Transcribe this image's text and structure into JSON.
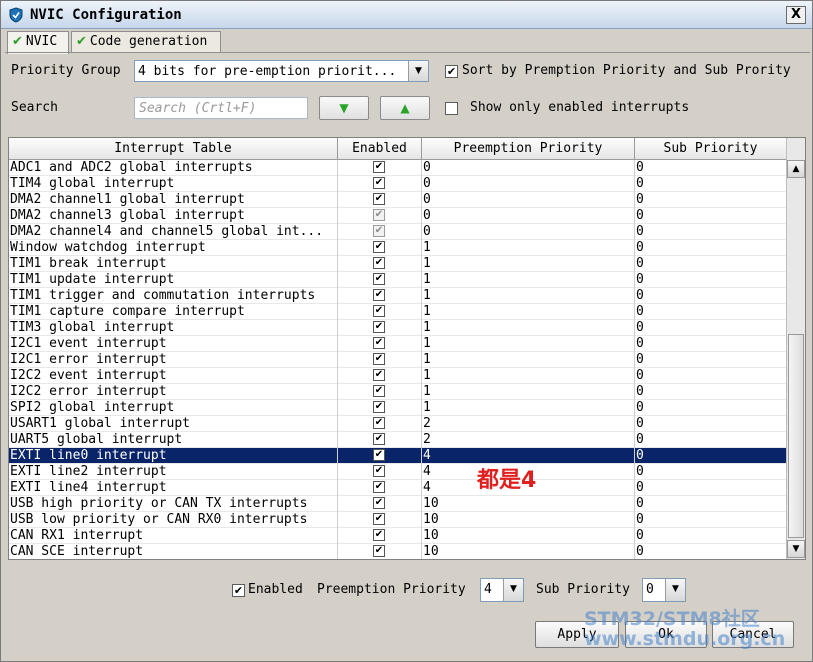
{
  "window": {
    "title": "NVIC Configuration",
    "close_label": "X"
  },
  "tabs": [
    {
      "label": "NVIC"
    },
    {
      "label": "Code generation"
    }
  ],
  "priority_group": {
    "label": "Priority Group",
    "value": "4 bits for pre-emption priorit..."
  },
  "sort": {
    "label": "Sort by Premption Priority and Sub Prority",
    "checked": true
  },
  "search": {
    "label": "Search",
    "placeholder": "Search (Crtl+F)"
  },
  "show_only_enabled": {
    "label": "Show only enabled interrupts",
    "checked": false
  },
  "table": {
    "columns": [
      "Interrupt Table",
      "Enabled",
      "Preemption Priority",
      "Sub Priority"
    ],
    "rows": [
      {
        "name": "ADC1 and ADC2 global interrupts",
        "enabled": true,
        "locked": false,
        "preemption": "0",
        "sub": "0"
      },
      {
        "name": "TIM4 global interrupt",
        "enabled": true,
        "locked": false,
        "preemption": "0",
        "sub": "0"
      },
      {
        "name": "DMA2 channel1 global interrupt",
        "enabled": true,
        "locked": false,
        "preemption": "0",
        "sub": "0"
      },
      {
        "name": "DMA2 channel3 global interrupt",
        "enabled": true,
        "locked": true,
        "preemption": "0",
        "sub": "0"
      },
      {
        "name": "DMA2 channel4 and channel5 global int...",
        "enabled": true,
        "locked": true,
        "preemption": "0",
        "sub": "0"
      },
      {
        "name": "Window watchdog interrupt",
        "enabled": true,
        "locked": false,
        "preemption": "1",
        "sub": "0"
      },
      {
        "name": "TIM1 break interrupt",
        "enabled": true,
        "locked": false,
        "preemption": "1",
        "sub": "0"
      },
      {
        "name": "TIM1 update interrupt",
        "enabled": true,
        "locked": false,
        "preemption": "1",
        "sub": "0"
      },
      {
        "name": "TIM1 trigger and commutation interrupts",
        "enabled": true,
        "locked": false,
        "preemption": "1",
        "sub": "0"
      },
      {
        "name": "TIM1 capture compare interrupt",
        "enabled": true,
        "locked": false,
        "preemption": "1",
        "sub": "0"
      },
      {
        "name": "TIM3 global interrupt",
        "enabled": true,
        "locked": false,
        "preemption": "1",
        "sub": "0"
      },
      {
        "name": "I2C1 event interrupt",
        "enabled": true,
        "locked": false,
        "preemption": "1",
        "sub": "0"
      },
      {
        "name": "I2C1 error interrupt",
        "enabled": true,
        "locked": false,
        "preemption": "1",
        "sub": "0"
      },
      {
        "name": "I2C2 event interrupt",
        "enabled": true,
        "locked": false,
        "preemption": "1",
        "sub": "0"
      },
      {
        "name": "I2C2 error interrupt",
        "enabled": true,
        "locked": false,
        "preemption": "1",
        "sub": "0"
      },
      {
        "name": "SPI2 global interrupt",
        "enabled": true,
        "locked": false,
        "preemption": "1",
        "sub": "0"
      },
      {
        "name": "USART1 global interrupt",
        "enabled": true,
        "locked": false,
        "preemption": "2",
        "sub": "0"
      },
      {
        "name": "UART5 global interrupt",
        "enabled": true,
        "locked": false,
        "preemption": "2",
        "sub": "0"
      },
      {
        "name": "EXTI line0 interrupt",
        "enabled": true,
        "locked": false,
        "preemption": "4",
        "sub": "0",
        "selected": true
      },
      {
        "name": "EXTI line2 interrupt",
        "enabled": true,
        "locked": false,
        "preemption": "4",
        "sub": "0"
      },
      {
        "name": "EXTI line4 interrupt",
        "enabled": true,
        "locked": false,
        "preemption": "4",
        "sub": "0"
      },
      {
        "name": "USB high priority or CAN TX interrupts",
        "enabled": true,
        "locked": false,
        "preemption": "10",
        "sub": "0"
      },
      {
        "name": "USB low priority or CAN RX0 interrupts",
        "enabled": true,
        "locked": false,
        "preemption": "10",
        "sub": "0"
      },
      {
        "name": "CAN RX1 interrupt",
        "enabled": true,
        "locked": false,
        "preemption": "10",
        "sub": "0"
      },
      {
        "name": "CAN SCE interrupt",
        "enabled": true,
        "locked": false,
        "preemption": "10",
        "sub": "0"
      }
    ]
  },
  "annotation": "都是4",
  "bottom": {
    "enabled_label": "Enabled",
    "preemption_label": "Preemption Priority",
    "preemption_value": "4",
    "sub_label": "Sub Priority",
    "sub_value": "0"
  },
  "buttons": {
    "apply": "Apply",
    "ok": "Ok",
    "cancel": "Cancel"
  },
  "watermark": {
    "line1": "STM32/STM8社区",
    "line2": "www.stmdu.org.cn"
  },
  "colors": {
    "selection": "#0a246a",
    "annotation": "#e02020",
    "check_green": "#2e9e2e"
  }
}
